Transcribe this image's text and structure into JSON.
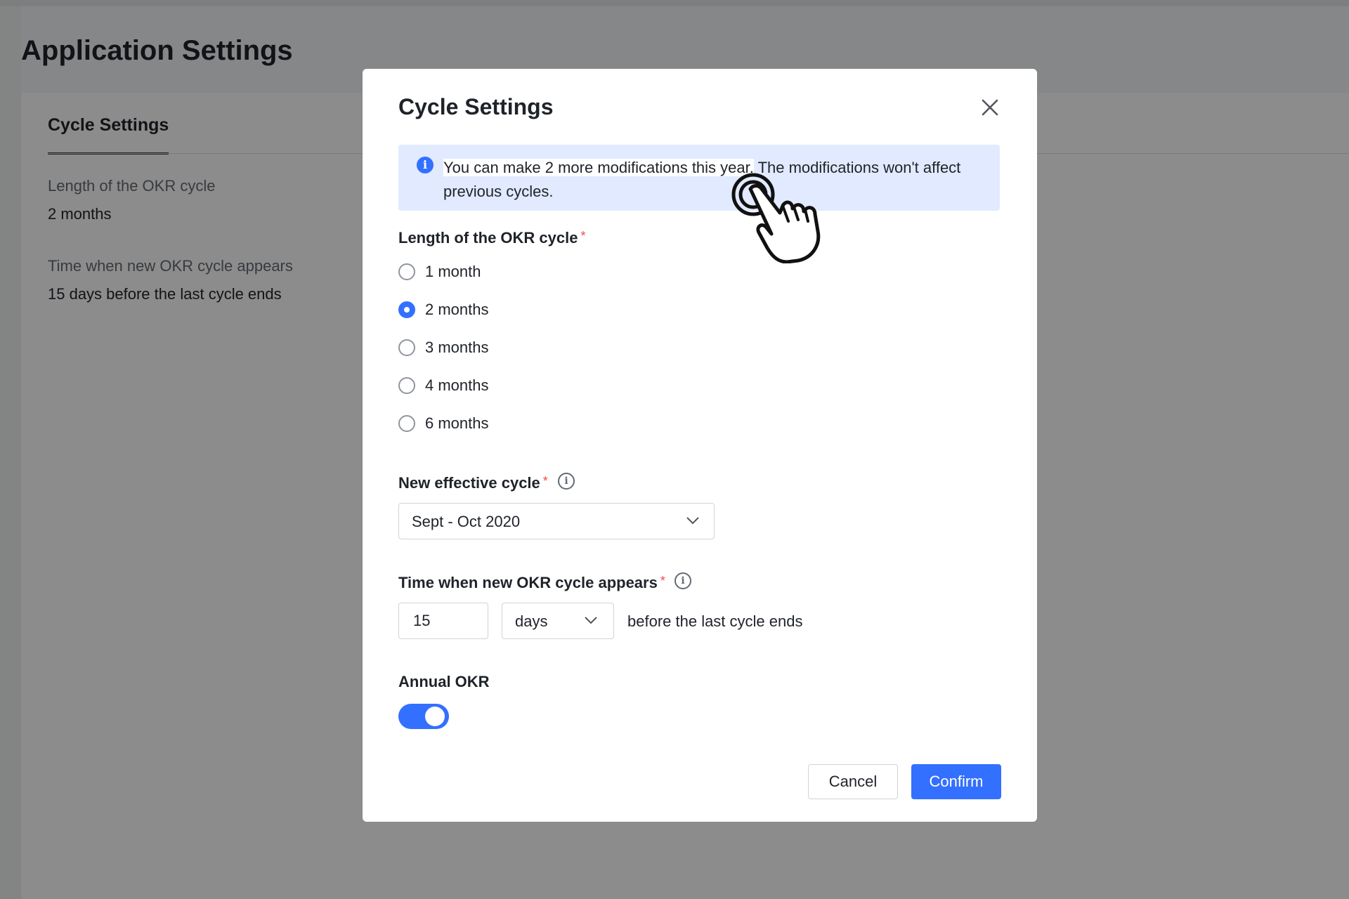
{
  "background": {
    "page_title": "Application Settings",
    "tab_label": "Cycle Settings",
    "fields": [
      {
        "label": "Length of the OKR cycle",
        "value": "2 months"
      },
      {
        "label": "Time when new OKR cycle appears",
        "value": "15 days before the last cycle ends"
      }
    ]
  },
  "modal": {
    "title": "Cycle Settings",
    "close_icon": "close-icon",
    "notice": {
      "icon": "info-icon",
      "highlighted_text": "You can make 2 more modifications this year.",
      "rest_text": " The modifications won't affect previous cycles."
    },
    "cycle_length": {
      "label": "Length of the OKR cycle",
      "required_mark": "*",
      "options": [
        "1 month",
        "2 months",
        "3 months",
        "4 months",
        "6 months"
      ],
      "selected": "2 months"
    },
    "effective_cycle": {
      "label": "New effective cycle",
      "required_mark": "*",
      "info_icon": "info-circle-icon",
      "value": "Sept - Oct 2020"
    },
    "appear_time": {
      "label": "Time when new OKR cycle appears",
      "required_mark": "*",
      "info_icon": "info-circle-icon",
      "amount": "15",
      "unit": "days",
      "suffix": "before the last cycle ends"
    },
    "annual_okr": {
      "label": "Annual OKR",
      "enabled": true
    },
    "buttons": {
      "cancel": "Cancel",
      "confirm": "Confirm"
    }
  },
  "colors": {
    "accent": "#3370ff",
    "required": "#f54a45",
    "notice_bg": "#e1eaff",
    "overlay": "rgba(0,0,0,0.45)"
  },
  "cursor": "pointing-hand-click-icon"
}
